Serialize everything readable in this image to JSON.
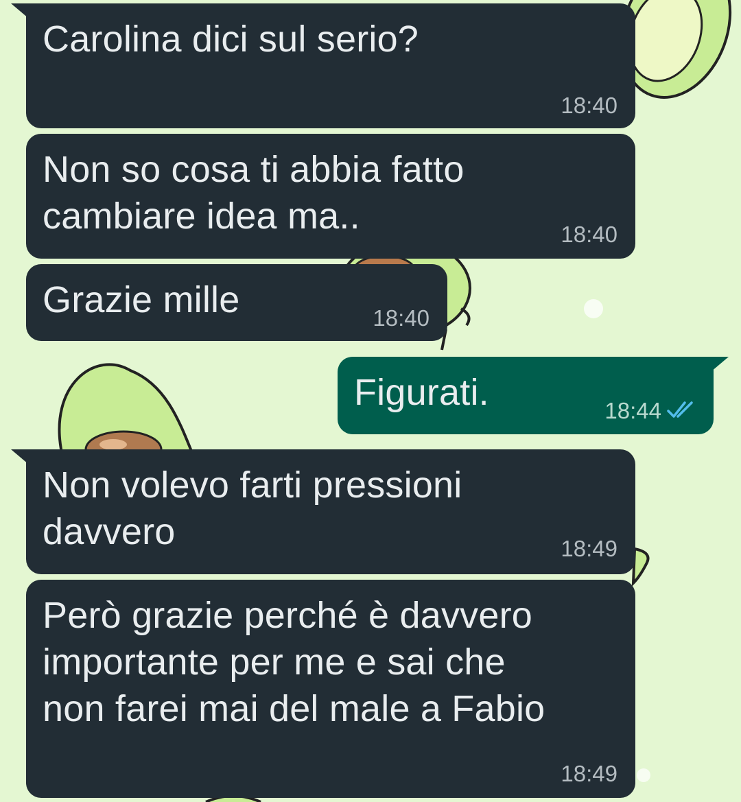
{
  "colors": {
    "incoming_bubble": "#222d35",
    "outgoing_bubble": "#005e4d",
    "wallpaper": "#e4f7d2",
    "read_ticks": "#53bdeb"
  },
  "messages": [
    {
      "direction": "incoming",
      "text": "Carolina dici sul serio?",
      "time": "18:40"
    },
    {
      "direction": "incoming",
      "text": "Non so cosa ti abbia fatto\ncambiare idea ma..",
      "time": "18:40"
    },
    {
      "direction": "incoming",
      "text": "Grazie mille",
      "time": "18:40"
    },
    {
      "direction": "outgoing",
      "text": "Figurati.",
      "time": "18:44",
      "status_icon": "double-check-read-icon"
    },
    {
      "direction": "incoming",
      "text": "Non volevo farti pressioni\ndavvero",
      "time": "18:49"
    },
    {
      "direction": "incoming",
      "text": "Però grazie perché è davvero\nimportante per me e sai che\nnon farei mai del male a Fabio",
      "time": "18:49"
    }
  ]
}
